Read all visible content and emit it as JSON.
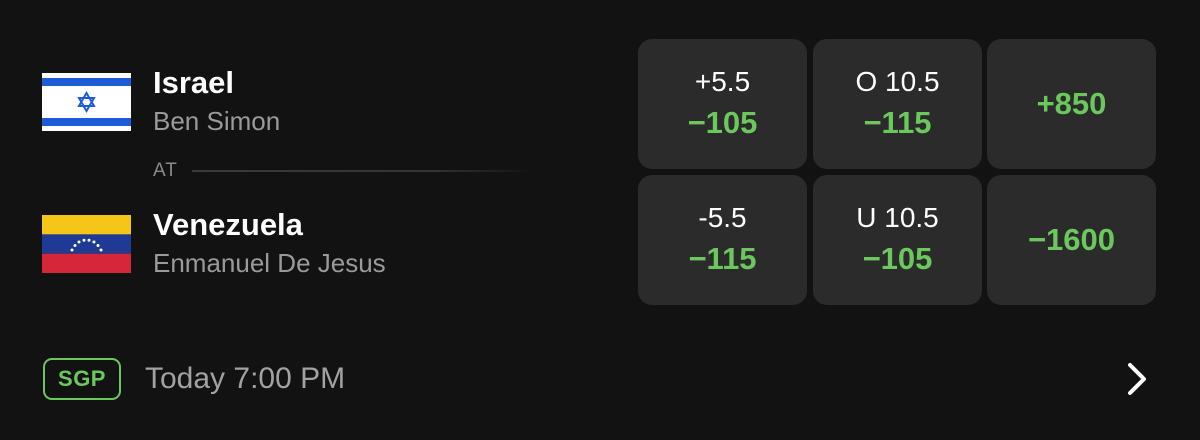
{
  "matchup": {
    "away": {
      "team": "Israel",
      "player": "Ben Simon",
      "flag_icon": "israel-flag-icon"
    },
    "separator": "AT",
    "home": {
      "team": "Venezuela",
      "player": "Enmanuel De Jesus",
      "flag_icon": "venezuela-flag-icon"
    }
  },
  "odds": {
    "away": {
      "spread_line": "+5.5",
      "spread_odds": "−105",
      "total_line": "O 10.5",
      "total_odds": "−115",
      "moneyline": "+850"
    },
    "home": {
      "spread_line": "-5.5",
      "spread_odds": "−115",
      "total_line": "U 10.5",
      "total_odds": "−105",
      "moneyline": "−1600"
    }
  },
  "footer": {
    "badge": "SGP",
    "time": "Today 7:00 PM",
    "chevron_icon": "chevron-right-icon"
  },
  "colors": {
    "background": "#121212",
    "cell": "#2b2b2b",
    "odds_green": "#6bc85c",
    "muted_text": "#9a9a9a"
  }
}
